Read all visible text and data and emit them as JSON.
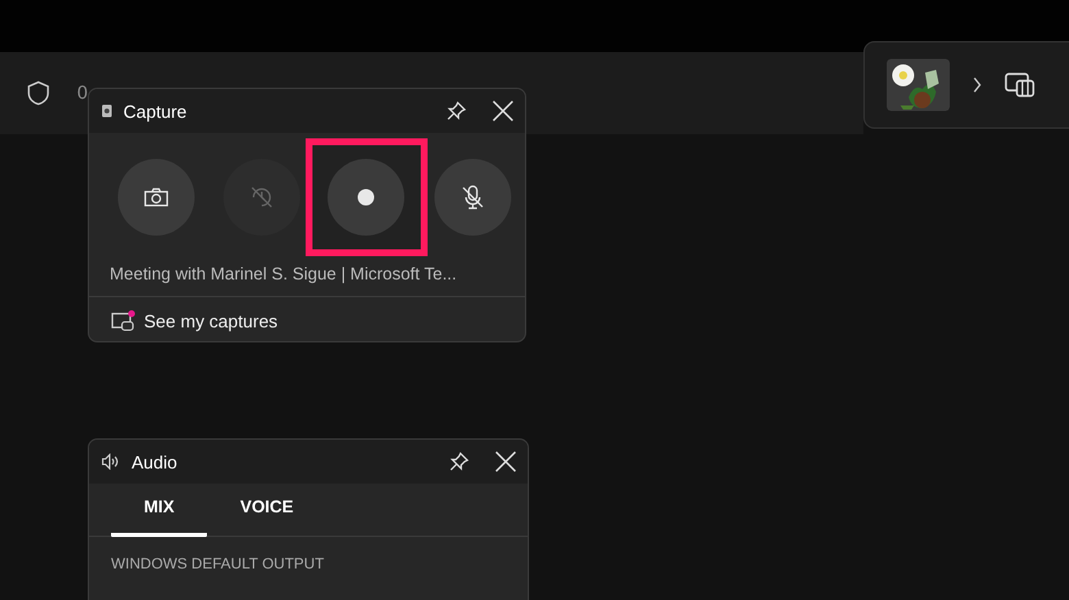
{
  "top_bar": {
    "text": "0"
  },
  "capture": {
    "title": "Capture",
    "buttons": [
      {
        "kind": "screenshot",
        "disabled": false,
        "highlighted": false
      },
      {
        "kind": "record-last",
        "disabled": true,
        "highlighted": false
      },
      {
        "kind": "record",
        "disabled": false,
        "highlighted": true
      },
      {
        "kind": "mic",
        "disabled": false,
        "highlighted": false
      }
    ],
    "target": "Meeting with Marinel S. Sigue | Microsoft Te...",
    "link": "See my captures",
    "link_badge": true
  },
  "audio": {
    "title": "Audio",
    "tabs": [
      {
        "label": "MIX",
        "selected": true
      },
      {
        "label": "VOICE",
        "selected": false
      }
    ],
    "section": "WINDOWS DEFAULT OUTPUT"
  }
}
